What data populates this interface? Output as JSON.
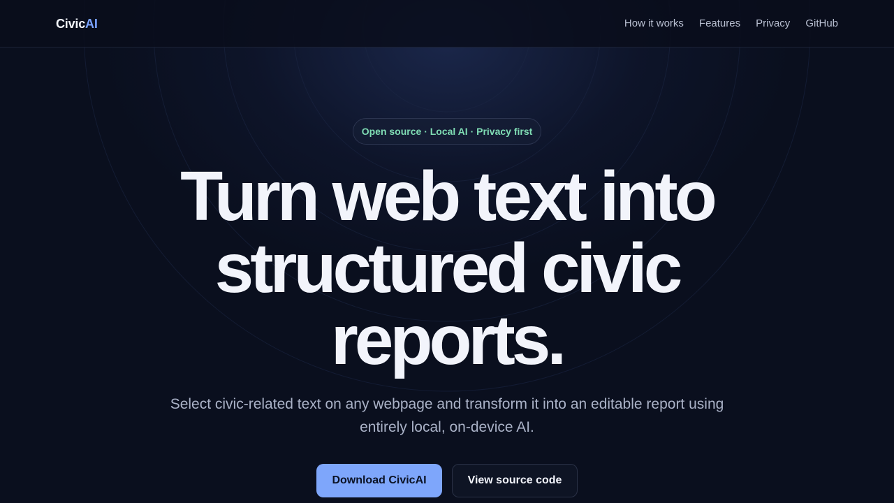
{
  "header": {
    "logo": {
      "primary": "Civic",
      "accent": "AI"
    },
    "nav": [
      {
        "label": "How it works"
      },
      {
        "label": "Features"
      },
      {
        "label": "Privacy"
      },
      {
        "label": "GitHub"
      }
    ]
  },
  "hero": {
    "badge": "Open source · Local AI · Privacy first",
    "headline": {
      "line1": "Turn web text into",
      "line2": "structured civic",
      "line3": "reports."
    },
    "subtitle": "Select civic-related text on any webpage and transform it into an editable report using entirely local, on-device AI.",
    "primary_button": "Download CivicAI",
    "secondary_button": "View source code"
  },
  "colors": {
    "background": "#0a0f1e",
    "accent": "#7ea6fb",
    "badge_text": "#7fdcb4",
    "heading": "#f2f4fb",
    "muted_text": "#aab2c7"
  }
}
